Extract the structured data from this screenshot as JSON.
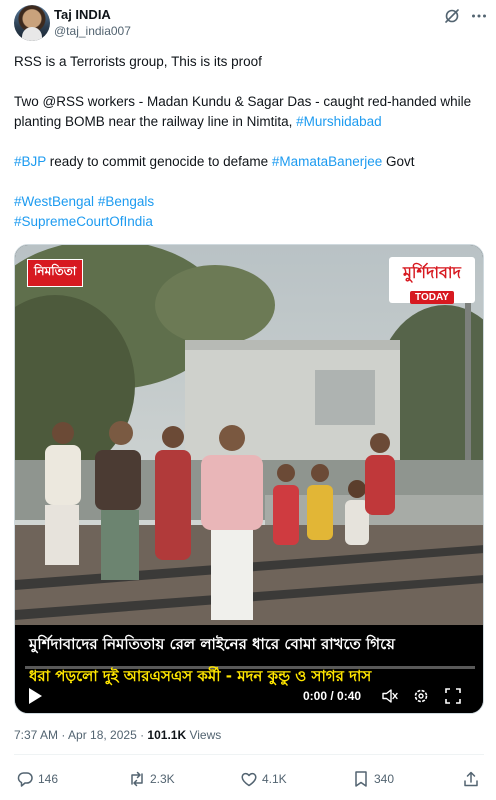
{
  "author": {
    "name": "Taj INDIA",
    "handle": "@taj_india007"
  },
  "tweet": {
    "line1": "RSS is a Terrorists group, This is its proof",
    "para2_a": "Two @RSS workers - Madan Kundu & Sagar Das - caught red-handed while planting BOMB near the railway line in Nimtita, ",
    "para2_tag": "#Murshidabad",
    "para3_tag1": "#BJP",
    "para3_mid": " ready to commit genocide to defame ",
    "para3_tag2": "#MamataBanerjee",
    "para3_end": " Govt",
    "tags_line1_a": "#WestBengal",
    "tags_line1_b": "#Bengals",
    "tags_line2": "#SupremeCourtOfIndia"
  },
  "video": {
    "location_badge": "নিমতিতা",
    "brand_main": "মুর্শিদাবাদ",
    "brand_sub": "TODAY",
    "caption_line1": "মুর্শিদাবাদের নিমতিতায় রেল লাইনের ধারে বোমা রাখতে গিয়ে",
    "caption_line2": "ধরা পড়লো দুই আরএসএস কর্মী - মদন কুন্ডু ও সাগর দাস",
    "timecode": "0:00 / 0:40",
    "progress": 0.0
  },
  "meta": {
    "timestamp": "7:37 AM · Apr 18, 2025 · ",
    "views_count": "101.1K",
    "views_label": " Views"
  },
  "actions": {
    "replies": "146",
    "reposts": "2.3K",
    "likes": "4.1K",
    "bookmarks": "340"
  },
  "colors": {
    "accent": "#1d9bf0",
    "text": "#0f1419",
    "muted": "#536471",
    "badge_red": "#d71920",
    "caption_yellow": "#ffe600"
  },
  "icons": [
    "grok-icon",
    "more-icon",
    "play-icon",
    "volume-icon",
    "settings-icon",
    "fullscreen-icon",
    "reply-icon",
    "repost-icon",
    "like-icon",
    "bookmark-icon",
    "share-icon"
  ]
}
